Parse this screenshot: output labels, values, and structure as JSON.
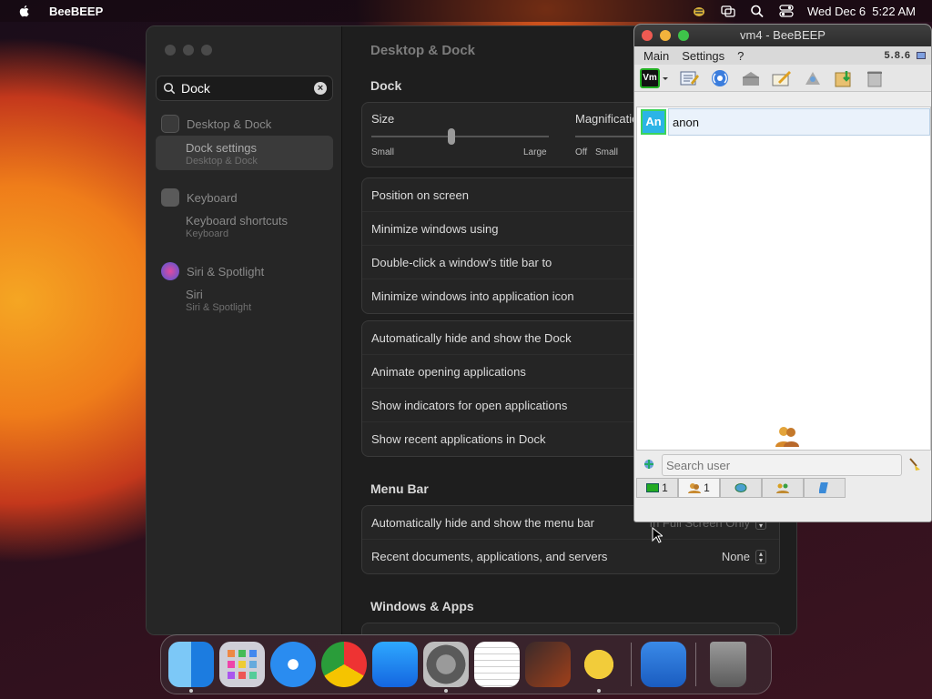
{
  "menubar": {
    "app_name": "BeeBEEP",
    "clock": "Wed Dec 6  5:22 AM"
  },
  "settings": {
    "search_value": "Dock",
    "sidebar": {
      "group1": "Desktop & Dock",
      "item1_title": "Dock settings",
      "item1_sub": "Desktop & Dock",
      "group2": "Keyboard",
      "item2_title": "Keyboard shortcuts",
      "item2_sub": "Keyboard",
      "group3": "Siri & Spotlight",
      "item3_title": "Siri",
      "item3_sub": "Siri & Spotlight"
    },
    "title": "Desktop & Dock",
    "dock_heading": "Dock",
    "size_label": "Size",
    "size_small": "Small",
    "size_large": "Large",
    "size_level_pct": 45,
    "magnification_label": "Magnification",
    "mag_off": "Off",
    "mag_small": "Small",
    "rows_group1": [
      "Position on screen",
      "Minimize windows using",
      "Double-click a window's title bar to",
      "Minimize windows into application icon"
    ],
    "rows_group2": [
      "Automatically hide and show the Dock",
      "Animate opening applications",
      "Show indicators for open applications",
      "Show recent applications in Dock"
    ],
    "menubar_heading": "Menu Bar",
    "menubar_row1": "Automatically hide and show the menu bar",
    "menubar_row1_value": "In Full Screen Only",
    "menubar_row2": "Recent documents, applications, and servers",
    "menubar_row2_value": "None",
    "windows_heading": "Windows & Apps"
  },
  "beebeep": {
    "title": "vm4 - BeeBEEP",
    "menu_main": "Main",
    "menu_settings": "Settings",
    "menu_help": "?",
    "version": "5.8.6",
    "vm_badge": "Vm",
    "user_avatar": "An",
    "user_name": "anon",
    "search_placeholder": "Search user",
    "tab1_count": "1",
    "tab2_count": "1"
  },
  "dock": {
    "apps": [
      "finder-icon",
      "launchpad-icon",
      "safari-icon",
      "chrome-icon",
      "app-store-icon",
      "system-settings-icon",
      "textedit-icon",
      "garageband-icon",
      "beebeep-icon",
      "weather-icon",
      "trash-icon"
    ]
  },
  "colors": {
    "accent_green": "#23b023",
    "avatar_blue": "#2bb4e6"
  }
}
